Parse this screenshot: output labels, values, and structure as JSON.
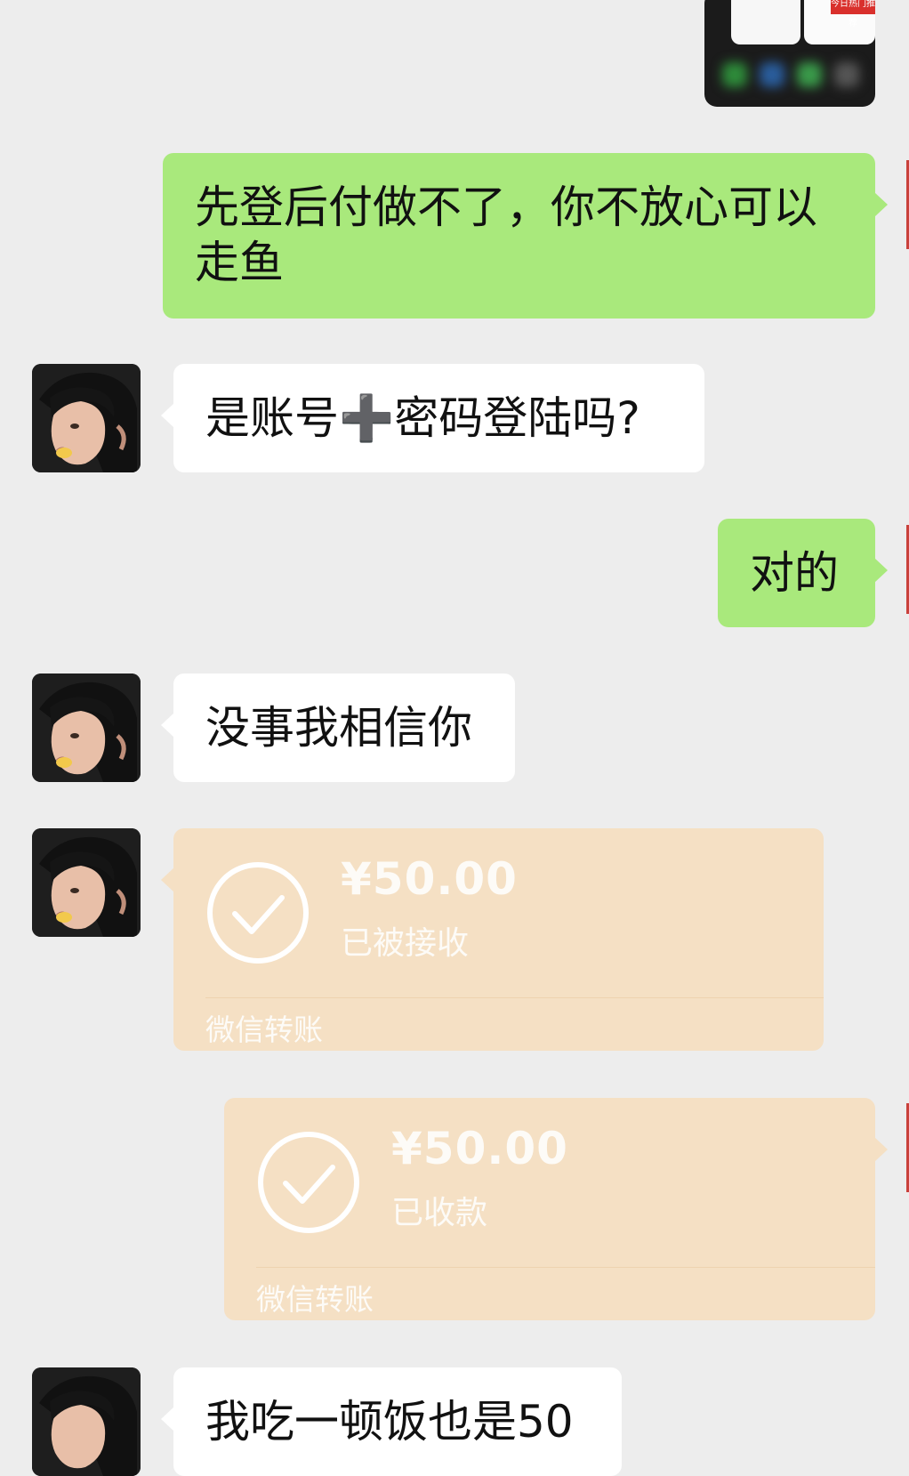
{
  "messages": {
    "m1": {
      "text": "先登后付做不了，你不放心可以走鱼"
    },
    "m2": {
      "text": "是账号➕密码登陆吗?"
    },
    "m3": {
      "text": "对的"
    },
    "m4": {
      "text": "没事我相信你"
    },
    "m5": {
      "amount": "¥50.00",
      "status": "已被接收",
      "footer": "微信转账"
    },
    "m6": {
      "amount": "¥50.00",
      "status": "已收款",
      "footer": "微信转账"
    },
    "m7": {
      "text": "我吃一顿饭也是50"
    }
  },
  "image_thumb": {
    "badge": "今日热门推荐"
  },
  "colors": {
    "background": "#ededed",
    "my_bubble": "#a9e97c",
    "their_bubble": "#ffffff",
    "transfer_card": "#f5e0c4"
  },
  "icons": {
    "avatar": "contact-avatar",
    "transfer": "check-circle-icon"
  }
}
